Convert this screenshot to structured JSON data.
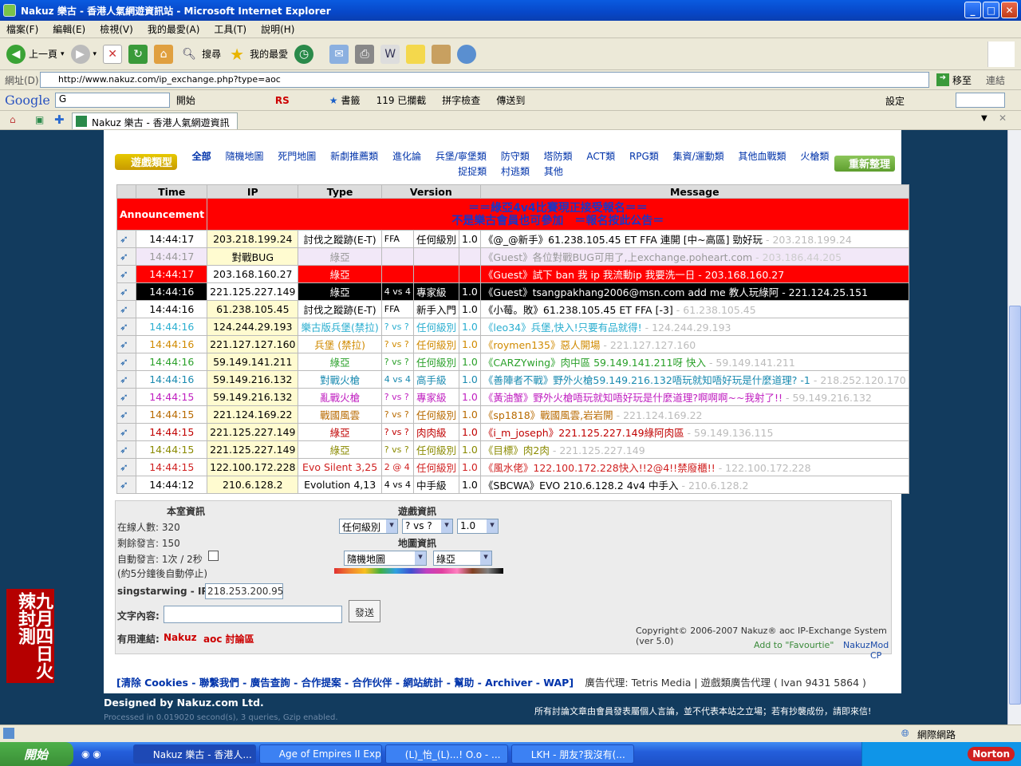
{
  "window": {
    "title": "Nakuz 樂古 - 香港人氣網遊資訊站 - Microsoft Internet Explorer"
  },
  "menu": [
    "檔案(F)",
    "編輯(E)",
    "檢視(V)",
    "我的最愛(A)",
    "工具(T)",
    "說明(H)"
  ],
  "toolbar": {
    "back": "上一頁",
    "search": "搜尋",
    "favorites": "我的最愛"
  },
  "address": {
    "label": "網址(D)",
    "url": "http://www.nakuz.com/ip_exchange.php?type=aoc",
    "go": "移至",
    "links": "連結"
  },
  "google_bar": {
    "brand": "Google",
    "input": "G",
    "open": "開始",
    "bookmarks": "書籤",
    "blocked": "119 已攔截",
    "spell": "拼字檢查",
    "send": "傳送到",
    "settings": "設定"
  },
  "tab": {
    "label": "Nakuz 樂古 - 香港人氣網遊資訊站"
  },
  "categories": {
    "logo": "遊戲類型",
    "reload": "重新整理",
    "items": [
      "全部",
      "隨機地圖",
      "死門地圖",
      "新劇推薦類",
      "進化論",
      "兵堡/寧堡類",
      "防守類",
      "塔防類",
      "ACT類",
      "RPG類",
      "集資/運動類",
      "其他血戰類",
      "火槍類",
      "捉捉類",
      "村逃類",
      "其他"
    ]
  },
  "table": {
    "headers": [
      "Time",
      "IP",
      "Type",
      "Version",
      "Message"
    ],
    "announcement": {
      "label": "Announcement",
      "line1": "＝＝綠亞4v4比賽現正接受報名＝＝",
      "line2": "不是樂古會員也可參加　＝報名按此公告＝"
    },
    "rows": [
      {
        "time": "14:44:17",
        "ip": "203.218.199.24",
        "type": "討伐之蹤跡(E-T)",
        "vs": "FFA",
        "lvl": "任何級別",
        "ver": "1.0",
        "msg": "《@_@新手》61.238.105.45 ET FFA 連開 [中~高區] 勁好玩",
        "tail": " - 203.218.199.24",
        "style": "normal"
      },
      {
        "time": "14:44:17",
        "ip": "對戰BUG",
        "type": "綠亞",
        "vs": "",
        "lvl": "",
        "ver": "",
        "msg": "《Guest》各位對戰BUG可用了,上exchange.poheart.com",
        "tail": " - 203.186.44.205",
        "style": "lavender"
      },
      {
        "time": "14:44:17",
        "ip": "203.168.160.27",
        "type": "綠亞",
        "vs": "",
        "lvl": "",
        "ver": "",
        "msg": "《Guest》試下 ban 我 ip 我流動ip 我要洗一日",
        "tail": " - 203.168.160.27",
        "style": "red"
      },
      {
        "time": "14:44:16",
        "ip": "221.125.227.149",
        "type": "綠亞",
        "vs": "4 vs 4",
        "lvl": "專家級",
        "ver": "1.0",
        "msg": "《Guest》tsangpakhang2006@msn.com add me 教人玩綠阿",
        "tail": " - 221.124.25.151",
        "style": "black"
      },
      {
        "time": "14:44:16",
        "ip": "61.238.105.45",
        "type": "討伐之蹤跡(E-T)",
        "vs": "FFA",
        "lvl": "新手入門",
        "ver": "1.0",
        "msg": "《小莓。敗》61.238.105.45 ET FFA [-3]",
        "tail": " - 61.238.105.45",
        "style": "normal"
      },
      {
        "time": "14:44:16",
        "ip": "124.244.29.193",
        "type": "樂古版兵堡(禁拉)",
        "vs": "? vs ?",
        "lvl": "任何級別",
        "ver": "1.0",
        "msg": "《leo34》兵堡,快入!只要有品就得!",
        "tail": " - 124.244.29.193",
        "style": "cyan"
      },
      {
        "time": "14:44:16",
        "ip": "221.127.127.160",
        "type": "兵堡 (禁拉)",
        "vs": "? vs ?",
        "lvl": "任何級別",
        "ver": "1.0",
        "msg": "《roymen135》惡人開場",
        "tail": " - 221.127.127.160",
        "style": "orange"
      },
      {
        "time": "14:44:16",
        "ip": "59.149.141.211",
        "type": "綠亞",
        "vs": "? vs ?",
        "lvl": "任何級別",
        "ver": "1.0",
        "msg": "《CARZYwing》肉中區 59.149.141.211呀 快入",
        "tail": " - 59.149.141.211",
        "style": "green"
      },
      {
        "time": "14:44:16",
        "ip": "59.149.216.132",
        "type": "對戰火槍",
        "vs": "4 vs 4",
        "lvl": "高手級",
        "ver": "1.0",
        "msg": "《善陣者不戰》野外火槍59.149.216.132唔玩就知唔好玩是什麼道理? -1",
        "tail": " - 218.252.120.170",
        "style": "teal"
      },
      {
        "time": "14:44:15",
        "ip": "59.149.216.132",
        "type": "亂戰火槍",
        "vs": "? vs ?",
        "lvl": "專家級",
        "ver": "1.0",
        "msg": "《黃油蟹》野外火槍唔玩就知唔好玩是什麼道理?啊啊啊~~我射了!!",
        "tail": " - 59.149.216.132",
        "style": "magenta"
      },
      {
        "time": "14:44:15",
        "ip": "221.124.169.22",
        "type": "戰國風雲",
        "vs": "? vs ?",
        "lvl": "任何級別",
        "ver": "1.0",
        "msg": "《sp1818》戰國風雲,岩岩開",
        "tail": " - 221.124.169.22",
        "style": "brown"
      },
      {
        "time": "14:44:15",
        "ip": "221.125.227.149",
        "type": "綠亞",
        "vs": "? vs ?",
        "lvl": "肉肉級",
        "ver": "1.0",
        "msg": "《i_m_joseph》221.125.227.149綠阿肉區",
        "tail": " - 59.149.136.115",
        "style": "darkred"
      },
      {
        "time": "14:44:15",
        "ip": "221.125.227.149",
        "type": "綠亞",
        "vs": "? vs ?",
        "lvl": "任何級別",
        "ver": "1.0",
        "msg": "《目標》肉2肉",
        "tail": " - 221.125.227.149",
        "style": "olive"
      },
      {
        "time": "14:44:15",
        "ip": "122.100.172.228",
        "type": "Evo Silent 3,25",
        "vs": "2 @ 4",
        "lvl": "任何級別",
        "ver": "1.0",
        "msg": "《風水佬》122.100.172.228快入!!2@4!!禁廢櫃!!",
        "tail": " - 122.100.172.228",
        "style": "crimson"
      },
      {
        "time": "14:44:12",
        "ip": "210.6.128.2",
        "type": "Evolution 4,13",
        "vs": "4 vs 4",
        "lvl": "中手級",
        "ver": "1.0",
        "msg": "《SBCWA》EVO 210.6.128.2 4v4 中手入",
        "tail": " - 210.6.128.2",
        "style": "navyplain"
      }
    ]
  },
  "form": {
    "room_title": "本室資訊",
    "online": "在線人數: 320",
    "remaining": "剩餘發言: 150",
    "auto": "自動發言: 1次 / 2秒",
    "auto_note": "(約5分鐘後自動停止)",
    "game_title": "遊戲資訊",
    "level": "任何級別",
    "vs": "? vs ?",
    "version": "1.0",
    "map_title": "地圖資訊",
    "map": "隨機地圖",
    "civ": "綠亞",
    "user_label": "singstarwing - IP:",
    "user_ip": "218.253.200.95",
    "text_label": "文字內容:",
    "send": "發送",
    "links_label": "有用連結:",
    "link1": "Nakuz",
    "link2": "aoc 討論區",
    "copyright": "Copyright© 2006-2007  Nakuz® aoc IP-Exchange System (ver 5.0)",
    "fav": "Add to \"Favourtie\"",
    "nakuz": "Nakuz",
    "modcp": "Mod CP"
  },
  "footer": {
    "nav": "[清除 Cookies - 聯繫我們 - 廣告查詢 - 合作提案 - 合作伙伴 - 網站統計 - 幫助 - Archiver - WAP]",
    "ad": "廣告代理: Tetris Media | 遊戲類廣告代理 ( Ivan 9431 5864 )",
    "designed": "Designed by Nakuz.com Ltd.",
    "processed": "Processed in 0.019020 second(s), 3 queries, Gzip enabled.",
    "disclaimer": "所有討論文章由會員發表屬個人言論，並不代表本站之立場；若有抄襲成份，請即來信!"
  },
  "side_ad": {
    "text": "九月四日火辣封測"
  },
  "statusbar": {
    "zone": "網際網路"
  },
  "taskbar": {
    "start": "開始",
    "tasks": [
      "Nakuz 樂古 - 香港人...",
      "Age of Empires II Exp...",
      "(L)_怡_(L)...! O.o - ...",
      "LKH - 朋友?我沒有(..."
    ],
    "norton": "Norton"
  }
}
